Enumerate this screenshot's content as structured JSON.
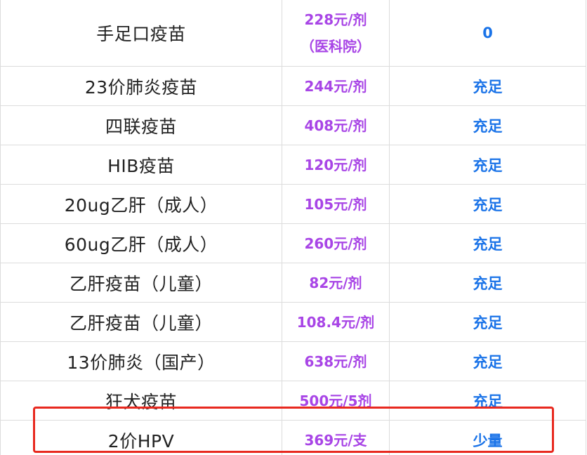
{
  "rows": [
    {
      "name": "手足口疫苗",
      "price": "228元/剂",
      "price_note": "（医科院）",
      "stock": "0"
    },
    {
      "name": "23价肺炎疫苗",
      "price": "244元/剂",
      "stock": "充足"
    },
    {
      "name": "四联疫苗",
      "price": "408元/剂",
      "stock": "充足"
    },
    {
      "name": "HIB疫苗",
      "price": "120元/剂",
      "stock": "充足"
    },
    {
      "name": "20ug乙肝（成人）",
      "price": "105元/剂",
      "stock": "充足"
    },
    {
      "name": "60ug乙肝（成人）",
      "price": "260元/剂",
      "stock": "充足"
    },
    {
      "name": "乙肝疫苗（儿童）",
      "price": "82元/剂",
      "stock": "充足"
    },
    {
      "name": "乙肝疫苗（儿童）",
      "price": "108.4元/剂",
      "stock": "充足"
    },
    {
      "name": "13价肺炎（国产）",
      "price": "638元/剂",
      "stock": "充足"
    },
    {
      "name": "狂犬疫苗",
      "price": "500元/5剂",
      "stock": "充足"
    },
    {
      "name": "2价HPV",
      "price": "369元/支",
      "stock": "少量"
    }
  ],
  "colors": {
    "price": "#a845e6",
    "stock": "#1a73e8",
    "highlight_border": "#e8291f"
  }
}
